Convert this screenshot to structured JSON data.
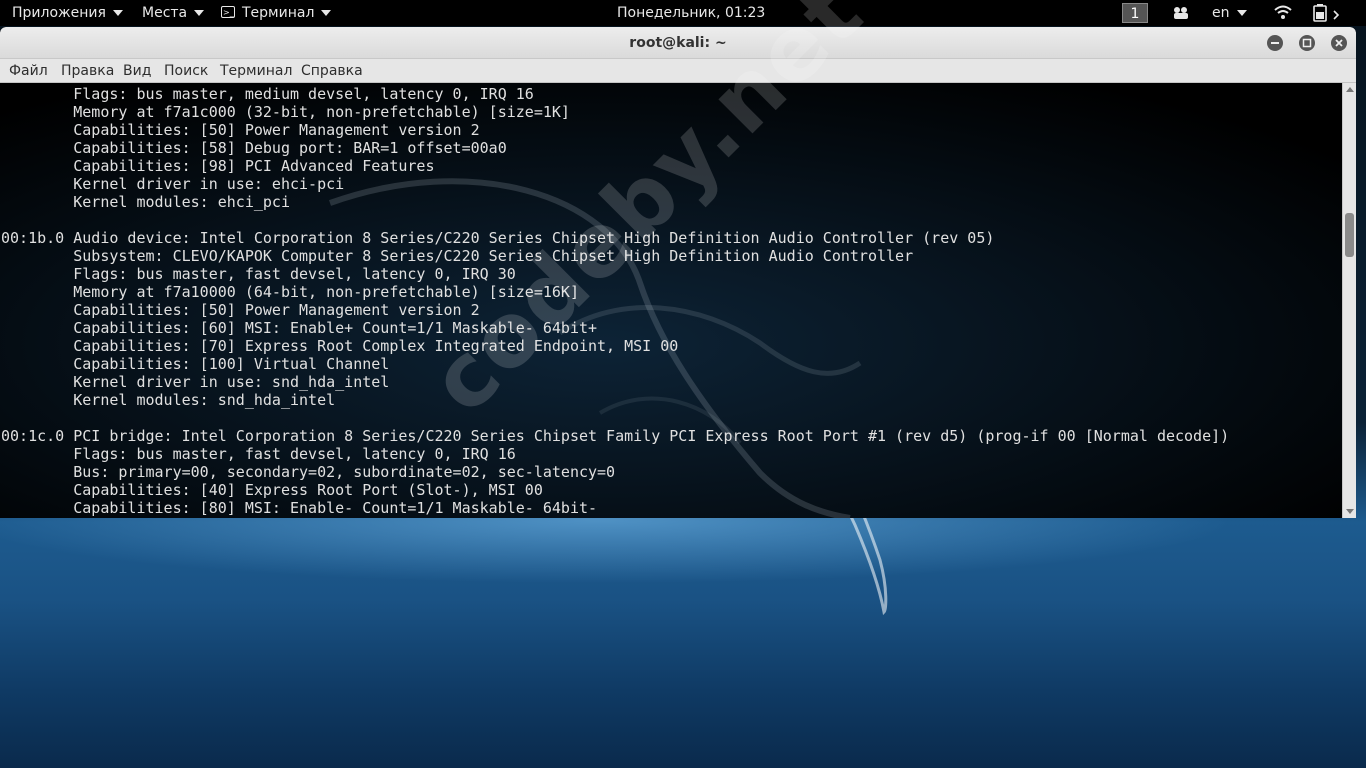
{
  "panel": {
    "applications": "Приложения",
    "places": "Места",
    "terminal_app": "Терминал",
    "clock": "Понедельник, 01:23",
    "workspace": "1",
    "keyboard_layout": "en",
    "icons": [
      "people-icon",
      "wifi-icon",
      "battery-power-icon"
    ]
  },
  "window": {
    "title": "root@kali: ~",
    "menu": [
      "Файл",
      "Правка",
      "Вид",
      "Поиск",
      "Терминал",
      "Справка"
    ]
  },
  "terminal": {
    "lines": [
      "        Flags: bus master, medium devsel, latency 0, IRQ 16",
      "        Memory at f7a1c000 (32-bit, non-prefetchable) [size=1K]",
      "        Capabilities: [50] Power Management version 2",
      "        Capabilities: [58] Debug port: BAR=1 offset=00a0",
      "        Capabilities: [98] PCI Advanced Features",
      "        Kernel driver in use: ehci-pci",
      "        Kernel modules: ehci_pci",
      "",
      "00:1b.0 Audio device: Intel Corporation 8 Series/C220 Series Chipset High Definition Audio Controller (rev 05)",
      "        Subsystem: CLEVO/KAPOK Computer 8 Series/C220 Series Chipset High Definition Audio Controller",
      "        Flags: bus master, fast devsel, latency 0, IRQ 30",
      "        Memory at f7a10000 (64-bit, non-prefetchable) [size=16K]",
      "        Capabilities: [50] Power Management version 2",
      "        Capabilities: [60] MSI: Enable+ Count=1/1 Maskable- 64bit+",
      "        Capabilities: [70] Express Root Complex Integrated Endpoint, MSI 00",
      "        Capabilities: [100] Virtual Channel",
      "        Kernel driver in use: snd_hda_intel",
      "        Kernel modules: snd_hda_intel",
      "",
      "00:1c.0 PCI bridge: Intel Corporation 8 Series/C220 Series Chipset Family PCI Express Root Port #1 (rev d5) (prog-if 00 [Normal decode])",
      "        Flags: bus master, fast devsel, latency 0, IRQ 16",
      "        Bus: primary=00, secondary=02, subordinate=02, sec-latency=0",
      "        Capabilities: [40] Express Root Port (Slot-), MSI 00",
      "        Capabilities: [80] MSI: Enable- Count=1/1 Maskable- 64bit-"
    ]
  },
  "watermark": "codeby.net",
  "colors": {
    "panel_bg": "#000000",
    "titlebar_bg": "#e0e0e0",
    "terminal_bg": "#000000",
    "terminal_fg": "#e0e0e0",
    "wallpaper_accent": "#1d5b8f"
  }
}
